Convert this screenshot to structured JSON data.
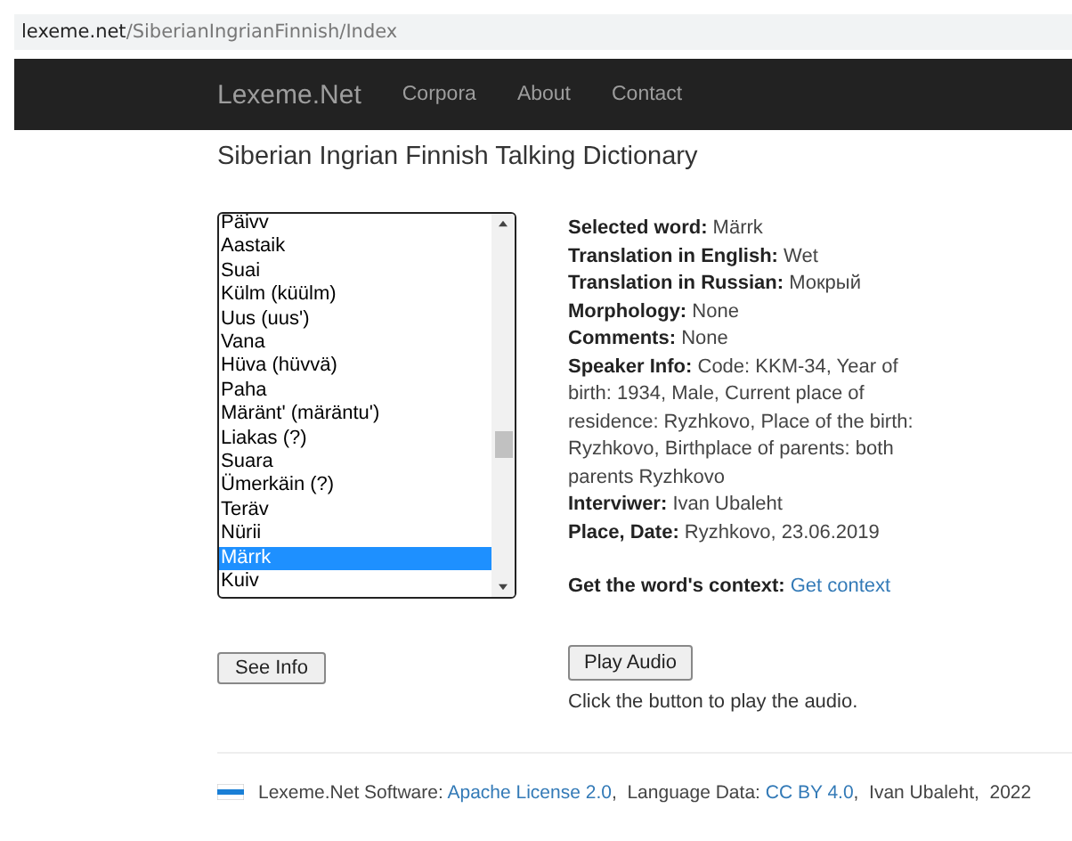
{
  "address_bar": {
    "host": "lexeme.net",
    "path": "/SiberianIngrianFinnish/Index"
  },
  "navbar": {
    "brand": "Lexeme.Net",
    "links": [
      "Corpora",
      "About",
      "Contact"
    ]
  },
  "title": "Siberian Ingrian Finnish Talking Dictionary",
  "word_list": [
    {
      "text": "Päivv",
      "selected": false
    },
    {
      "text": "Aastaik",
      "selected": false
    },
    {
      "text": "Suai",
      "selected": false
    },
    {
      "text": "Külm (küülm)",
      "selected": false
    },
    {
      "text": "Uus (uus')",
      "selected": false
    },
    {
      "text": "Vana",
      "selected": false
    },
    {
      "text": "Hüva (hüvvä)",
      "selected": false
    },
    {
      "text": "Paha",
      "selected": false
    },
    {
      "text": "Märänt' (märäntu')",
      "selected": false
    },
    {
      "text": "Liakas (?)",
      "selected": false
    },
    {
      "text": "Suara",
      "selected": false
    },
    {
      "text": "Ümerkäin (?)",
      "selected": false
    },
    {
      "text": "Teräv",
      "selected": false
    },
    {
      "text": "Nürii",
      "selected": false
    },
    {
      "text": "Märrk",
      "selected": true
    },
    {
      "text": "Kuiv",
      "selected": false
    }
  ],
  "details": [
    {
      "label": "Selected word:",
      "value": "Märrk"
    },
    {
      "label": "Translation in English:",
      "value": "Wet"
    },
    {
      "label": "Translation in Russian:",
      "value": "Мокрый"
    },
    {
      "label": "Morphology:",
      "value": "None"
    },
    {
      "label": "Comments:",
      "value": "None"
    },
    {
      "label": "Speaker Info:",
      "value": "Code: KKM-34, Year of birth: 1934, Male, Current place of residence: Ryzhkovo, Place of the birth: Ryzhkovo, Birthplace of parents: both parents Ryzhkovo"
    },
    {
      "label": "Interviwer:",
      "value": "Ivan Ubaleht"
    },
    {
      "label": "Place, Date:",
      "value": "Ryzhkovo, 23.06.2019"
    }
  ],
  "context": {
    "label": "Get the word's context:",
    "link": "Get context"
  },
  "see_info_button": "See Info",
  "play_audio_button": "Play Audio",
  "audio_hint": "Click the button to play the audio.",
  "footer": [
    {
      "kind": "text",
      "text": "Lexeme.Net Software: "
    },
    {
      "kind": "link",
      "text": "Apache License 2.0"
    },
    {
      "kind": "text",
      "text": ",  Language Data: "
    },
    {
      "kind": "link",
      "text": "CC BY 4.0"
    },
    {
      "kind": "text",
      "text": ",  Ivan Ubaleht,  2022"
    }
  ]
}
